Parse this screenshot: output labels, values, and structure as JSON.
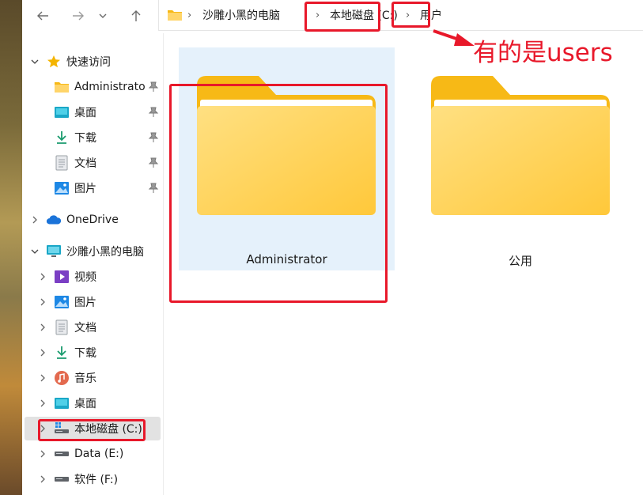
{
  "breadcrumb": {
    "items": [
      "沙雕小黑的电脑",
      "本地磁盘 (C:)",
      "用户"
    ]
  },
  "sidebar": {
    "quick_access": {
      "label": "快速访问",
      "items": [
        {
          "label": "Administrator",
          "icon": "folder-icon"
        },
        {
          "label": "桌面",
          "icon": "desktop-icon"
        },
        {
          "label": "下载",
          "icon": "download-icon"
        },
        {
          "label": "文档",
          "icon": "document-icon"
        },
        {
          "label": "图片",
          "icon": "pictures-icon"
        }
      ]
    },
    "onedrive": {
      "label": "OneDrive",
      "icon": "cloud-icon"
    },
    "this_pc": {
      "label": "沙雕小黑的电脑",
      "items": [
        {
          "label": "视频",
          "icon": "video-icon"
        },
        {
          "label": "图片",
          "icon": "pictures-icon"
        },
        {
          "label": "文档",
          "icon": "document-icon"
        },
        {
          "label": "下载",
          "icon": "download-icon"
        },
        {
          "label": "音乐",
          "icon": "music-icon"
        },
        {
          "label": "桌面",
          "icon": "desktop-icon"
        },
        {
          "label": "本地磁盘 (C:)",
          "icon": "drive-c-icon",
          "selected": true
        },
        {
          "label": "Data (E:)",
          "icon": "drive-icon"
        },
        {
          "label": "软件 (F:)",
          "icon": "drive-icon"
        }
      ]
    }
  },
  "content": {
    "folders": [
      {
        "label": "Administrator",
        "selected": true
      },
      {
        "label": "公用",
        "selected": false
      }
    ]
  },
  "annotation": {
    "text": "有的是users",
    "color": "#e8182a"
  },
  "colors": {
    "selection": "#e5f1fb",
    "sidebar_selected": "#e2e2e2",
    "folder_front": "#ffd56a",
    "folder_back": "#f7b916"
  }
}
